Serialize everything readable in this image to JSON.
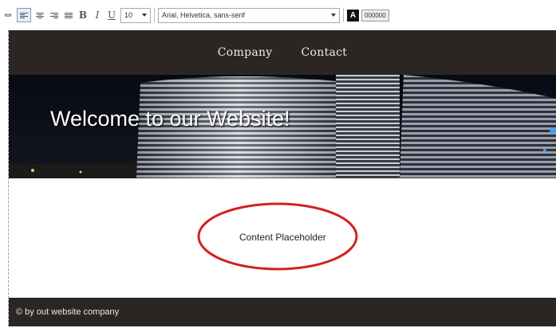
{
  "toolbar": {
    "font_size": "10",
    "font_family": "Arial, Helvetica, sans-serif",
    "color_label": "A",
    "color_hex": "000000"
  },
  "nav": {
    "items": [
      "Company",
      "Contact"
    ]
  },
  "hero": {
    "title": "Welcome to our Website!"
  },
  "content": {
    "placeholder": "Content Placeholder",
    "highlight_color": "#d42020"
  },
  "footer": {
    "text": "© by out website company"
  },
  "colors": {
    "header_bg": "#2b2624",
    "footer_bg": "#2b2624"
  }
}
